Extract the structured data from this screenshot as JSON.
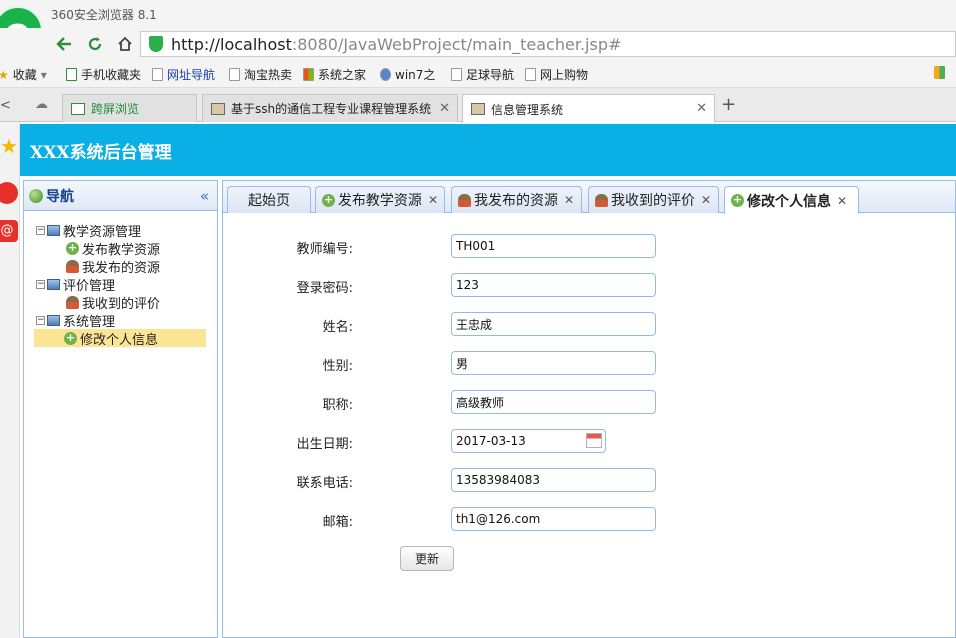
{
  "browser": {
    "app_title": "360安全浏览器 8.1",
    "url_host": "http://localhost",
    "url_rest": ":8080/JavaWebProject/main_teacher.jsp#",
    "bookmarks": [
      "收藏",
      "手机收藏夹",
      "网址导航",
      "淘宝热卖",
      "系统之家",
      "win7之",
      "足球导航",
      "网上购物"
    ],
    "tabs": [
      "跨屏浏览",
      "基于ssh的通信工程专业课程管理系统",
      "信息管理系统"
    ]
  },
  "app": {
    "title": "XXX系统后台管理",
    "nav_title": "导航",
    "tree": {
      "group1": "教学资源管理",
      "item1": "发布教学资源",
      "item2": "我发布的资源",
      "group2": "评价管理",
      "item3": "我收到的评价",
      "group3": "系统管理",
      "item4": "修改个人信息"
    },
    "tabs": [
      "起始页",
      "发布教学资源",
      "我发布的资源",
      "我收到的评价",
      "修改个人信息"
    ],
    "form": {
      "labels": [
        "教师编号:",
        "登录密码:",
        "姓名:",
        "性别:",
        "职称:",
        "出生日期:",
        "联系电话:",
        "邮箱:"
      ],
      "values": [
        "TH001",
        "123",
        "王忠成",
        "男",
        "高级教师",
        "2017-03-13",
        "13583984083",
        "th1@126.com"
      ],
      "submit": "更新"
    }
  },
  "colors": {
    "header": "#0aafe6",
    "panel_border": "#99bbe8",
    "selected": "#fbe595"
  }
}
